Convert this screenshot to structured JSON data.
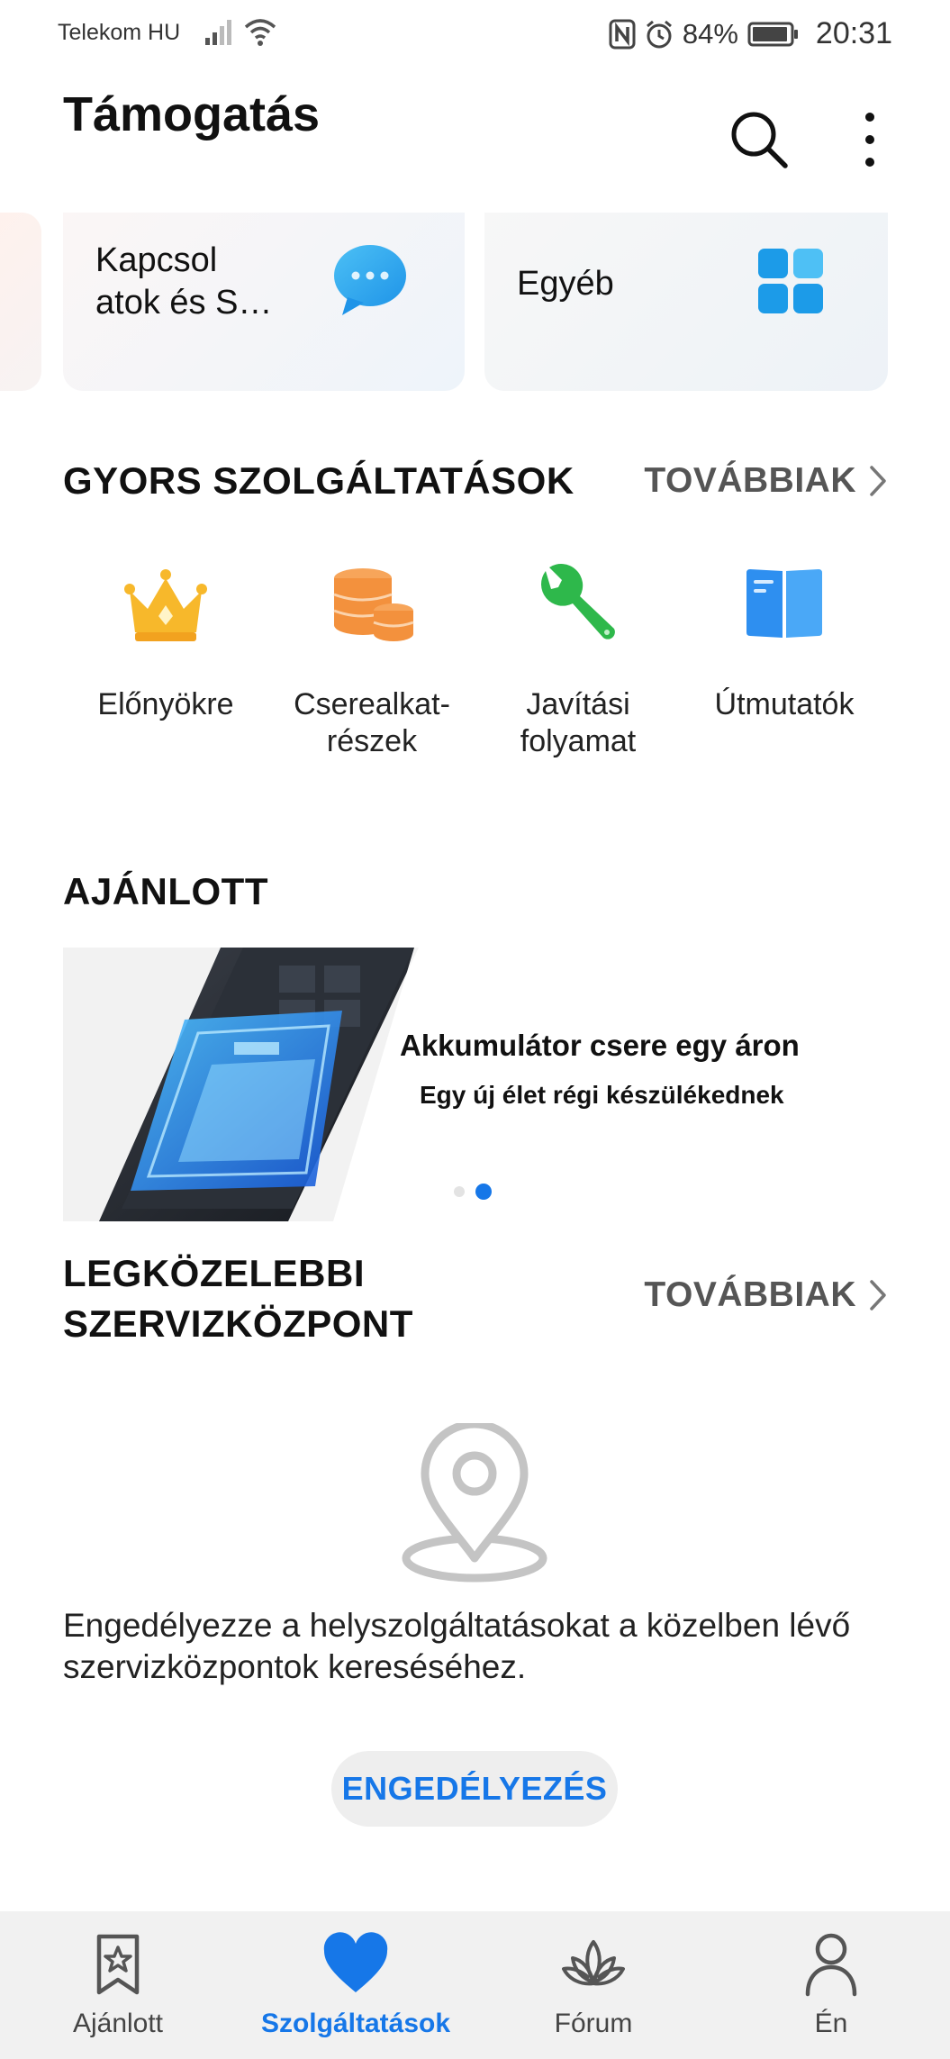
{
  "status_bar": {
    "carrier": "Telekom HU",
    "battery": "84%",
    "time": "20:31"
  },
  "header": {
    "title": "Támogatás"
  },
  "categories": [
    {
      "label": "Kapcsol atok és S…",
      "icon": "chat-bubble-icon"
    },
    {
      "label": "Egyéb",
      "icon": "grid-icon"
    }
  ],
  "quick_services": {
    "title": "GYORS SZOLGÁLTATÁSOK",
    "more_label": "TOVÁBBIAK",
    "items": [
      {
        "label": "Előnyökre",
        "icon": "crown-icon"
      },
      {
        "label": "Cserealkat-részek",
        "icon": "coins-icon"
      },
      {
        "label": "Javítási folyamat",
        "icon": "wrench-icon"
      },
      {
        "label": "Útmutatók",
        "icon": "book-icon"
      }
    ]
  },
  "recommended": {
    "title": "AJÁNLOTT",
    "banner_title": "Akkumulátor csere egy áron",
    "banner_subtitle": "Egy új élet régi készülékednek",
    "slide_count": 2,
    "active_slide": 2
  },
  "nearest": {
    "title": "LEGKÖZELEBBI SZERVIZKÖZPONT",
    "more_label": "TOVÁBBIAK",
    "location_prompt": "Engedélyezze a helyszolgáltatásokat a közelben lévő szervizközpontok kereséséhez.",
    "enable_label": "ENGEDÉLYEZÉS"
  },
  "bottom_nav": [
    {
      "label": "Ajánlott",
      "icon": "bookmark-star-icon",
      "active": false
    },
    {
      "label": "Szolgáltatások",
      "icon": "heart-icon",
      "active": true
    },
    {
      "label": "Fórum",
      "icon": "lotus-icon",
      "active": false
    },
    {
      "label": "Én",
      "icon": "person-icon",
      "active": false
    }
  ],
  "colors": {
    "accent": "#1677e8",
    "chat_icon": "#29a3f0",
    "crown": "#f7b82b",
    "coins": "#f3913d",
    "wrench": "#2eb84b",
    "book": "#2e8ff0"
  }
}
